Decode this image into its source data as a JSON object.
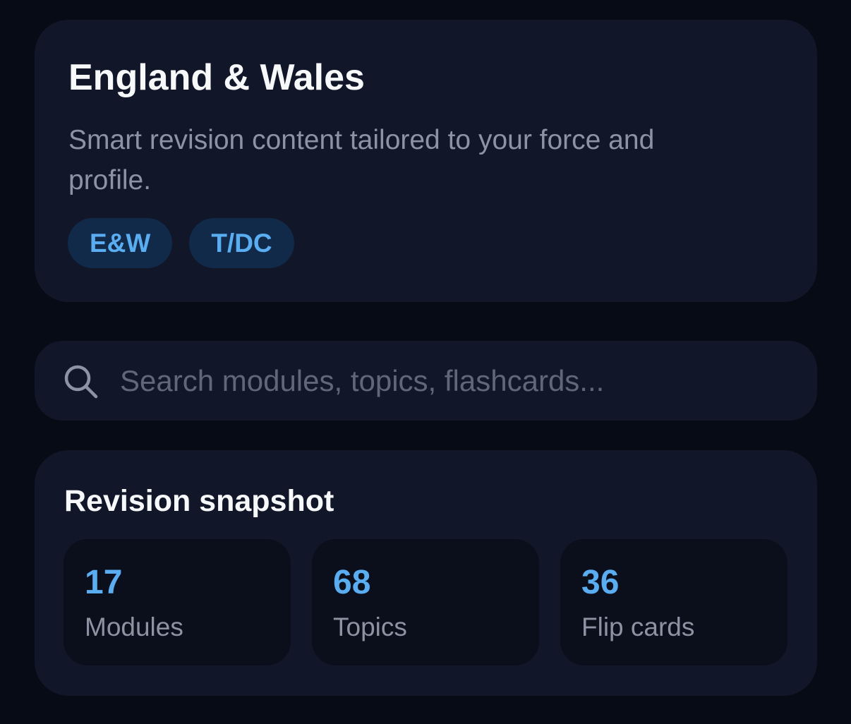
{
  "hero": {
    "title": "England & Wales",
    "subtitle": "Smart revision content tailored to your force and profile.",
    "chips": [
      {
        "label": "E&W"
      },
      {
        "label": "T/DC"
      }
    ]
  },
  "search": {
    "icon": "search-icon",
    "placeholder": "Search modules, topics, flashcards...",
    "value": ""
  },
  "snapshot": {
    "title": "Revision snapshot",
    "stats": [
      {
        "value": "17",
        "label": "Modules"
      },
      {
        "value": "68",
        "label": "Topics"
      },
      {
        "value": "36",
        "label": "Flip cards"
      }
    ]
  },
  "colors": {
    "background": "#070b15",
    "card": "#111729",
    "tile": "#0b0f1c",
    "accent": "#59adf0",
    "chip_bg": "#112a4a",
    "muted_text": "#8d93a3",
    "primary_text": "#f7f8fa"
  }
}
